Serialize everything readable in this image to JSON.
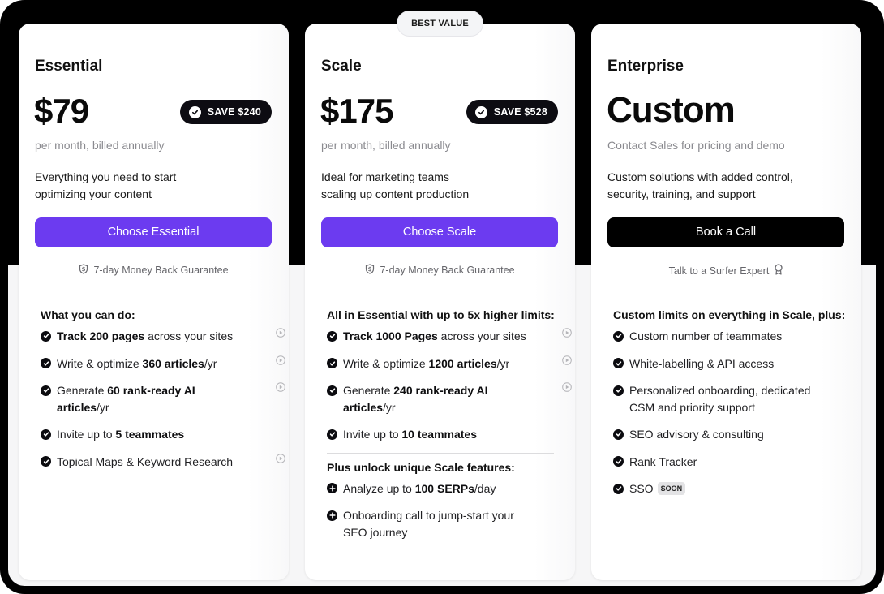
{
  "best_value_badge": "BEST VALUE",
  "plans": [
    {
      "name": "Essential",
      "price": "$79",
      "save_badge": "SAVE $240",
      "billing": "per month, billed annually",
      "description": [
        "Everything you need to start",
        "optimizing your content"
      ],
      "cta_label": "Choose Essential",
      "guarantee": "7-day Money Back Guarantee",
      "features_heading": "What you can do:",
      "features": [
        {
          "bold_prefix": "Track 200 pages",
          "text": " across your sites",
          "video": true
        },
        {
          "text_before": "Write & optimize ",
          "bold": "360 articles",
          "text_after": "/yr",
          "video": true
        },
        {
          "text_before": "Generate ",
          "bold": "60 rank-ready AI articles",
          "text_after": "/yr",
          "video": true
        },
        {
          "text_before": "Invite up to ",
          "bold": "5 teammates",
          "text_after": "",
          "video": false
        },
        {
          "text_before": "Topical Maps & Keyword Research",
          "bold": "",
          "text_after": "",
          "video": true
        }
      ]
    },
    {
      "name": "Scale",
      "price": "$175",
      "save_badge": "SAVE $528",
      "billing": "per month, billed annually",
      "description": [
        "Ideal for marketing teams",
        "scaling up content production"
      ],
      "cta_label": "Choose Scale",
      "guarantee": "7-day Money Back Guarantee",
      "features_heading": "All in Essential with up to 5x higher limits:",
      "features": [
        {
          "bold_prefix": "Track 1000 Pages",
          "text": " across your sites",
          "video": true
        },
        {
          "text_before": "Write & optimize ",
          "bold": "1200 articles",
          "text_after": "/yr",
          "video": true
        },
        {
          "text_before": "Generate ",
          "bold": "240 rank-ready AI articles",
          "text_after": "/yr",
          "video": true
        },
        {
          "text_before": "Invite up to ",
          "bold": "10 teammates",
          "text_after": "",
          "video": false
        }
      ],
      "extra_heading": "Plus unlock unique Scale features:",
      "extra_features": [
        {
          "text_before": "Analyze up to ",
          "bold": "100 SERPs",
          "text_after": "/day"
        },
        {
          "text_before": "Onboarding call to jump-start your SEO journey",
          "bold": "",
          "text_after": ""
        }
      ]
    },
    {
      "name": "Enterprise",
      "price": "Custom",
      "billing": "Contact Sales for pricing and demo",
      "description": [
        "Custom solutions with added control,",
        "security, training, and support"
      ],
      "cta_label": "Book a Call",
      "guarantee": "Talk to a Surfer Expert",
      "features_heading": "Custom limits on everything in Scale, plus:",
      "features": [
        {
          "text_before": "Custom number of teammates"
        },
        {
          "text_before": "White-labelling & API access"
        },
        {
          "text_before": "Personalized onboarding, dedicated CSM and priority support"
        },
        {
          "text_before": "SEO advisory & consulting"
        },
        {
          "text_before": "Rank Tracker"
        },
        {
          "text_before": "SSO",
          "tag": "SOON"
        }
      ]
    }
  ],
  "colors": {
    "accent": "#6c3bf0",
    "dark": "#000000",
    "frame": "#000000"
  }
}
